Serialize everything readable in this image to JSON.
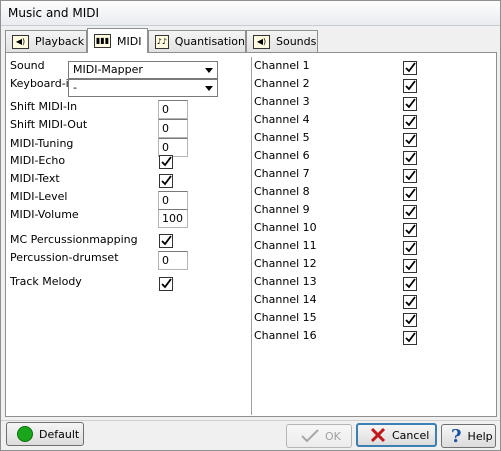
{
  "window": {
    "title": "Music and MIDI"
  },
  "tabs": [
    {
      "label": "Playback",
      "icon": "speaker-icon"
    },
    {
      "label": "MIDI",
      "icon": "midi-keyboard-icon"
    },
    {
      "label": "Quantisation",
      "icon": "notes-icon"
    },
    {
      "label": "Sounds",
      "icon": "speaker-icon"
    }
  ],
  "active_tab": "MIDI",
  "left": {
    "sound": {
      "label": "Sound",
      "value": "MIDI-Mapper"
    },
    "keyboard_in": {
      "label": "Keyboard-in",
      "value": "-"
    },
    "shift_midi_in": {
      "label": "Shift MIDI-In",
      "value": "0"
    },
    "shift_midi_out": {
      "label": "Shift MIDI-Out",
      "value": "0"
    },
    "midi_tuning": {
      "label": "MIDI-Tuning",
      "value": "0"
    },
    "midi_echo": {
      "label": "MIDI-Echo",
      "checked": true
    },
    "midi_text": {
      "label": "MIDI-Text",
      "checked": true
    },
    "midi_level": {
      "label": "MIDI-Level",
      "value": "0"
    },
    "midi_volume": {
      "label": "MIDI-Volume",
      "value": "100"
    },
    "mc_percussion": {
      "label": "MC Percussionmapping",
      "checked": true
    },
    "percussion_drumset": {
      "label": "Percussion-drumset",
      "value": "0"
    },
    "track_melody": {
      "label": "Track Melody",
      "checked": true
    }
  },
  "channels": [
    {
      "label": "Channel 1",
      "checked": true
    },
    {
      "label": "Channel 2",
      "checked": true
    },
    {
      "label": "Channel 3",
      "checked": true
    },
    {
      "label": "Channel 4",
      "checked": true
    },
    {
      "label": "Channel 5",
      "checked": true
    },
    {
      "label": "Channel 6",
      "checked": true
    },
    {
      "label": "Channel 7",
      "checked": true
    },
    {
      "label": "Channel 8",
      "checked": true
    },
    {
      "label": "Channel 9",
      "checked": true
    },
    {
      "label": "Channel 10",
      "checked": true
    },
    {
      "label": "Channel 11",
      "checked": true
    },
    {
      "label": "Channel 12",
      "checked": true
    },
    {
      "label": "Channel 13",
      "checked": true
    },
    {
      "label": "Channel 14",
      "checked": true
    },
    {
      "label": "Channel 15",
      "checked": true
    },
    {
      "label": "Channel 16",
      "checked": true
    }
  ],
  "buttons": {
    "default": "Default",
    "ok": "OK",
    "cancel": "Cancel",
    "help": "Help"
  },
  "colors": {
    "default_dot": "#1aa61a",
    "cancel_x": "#c0181a",
    "help_q": "#1d4fa3"
  }
}
